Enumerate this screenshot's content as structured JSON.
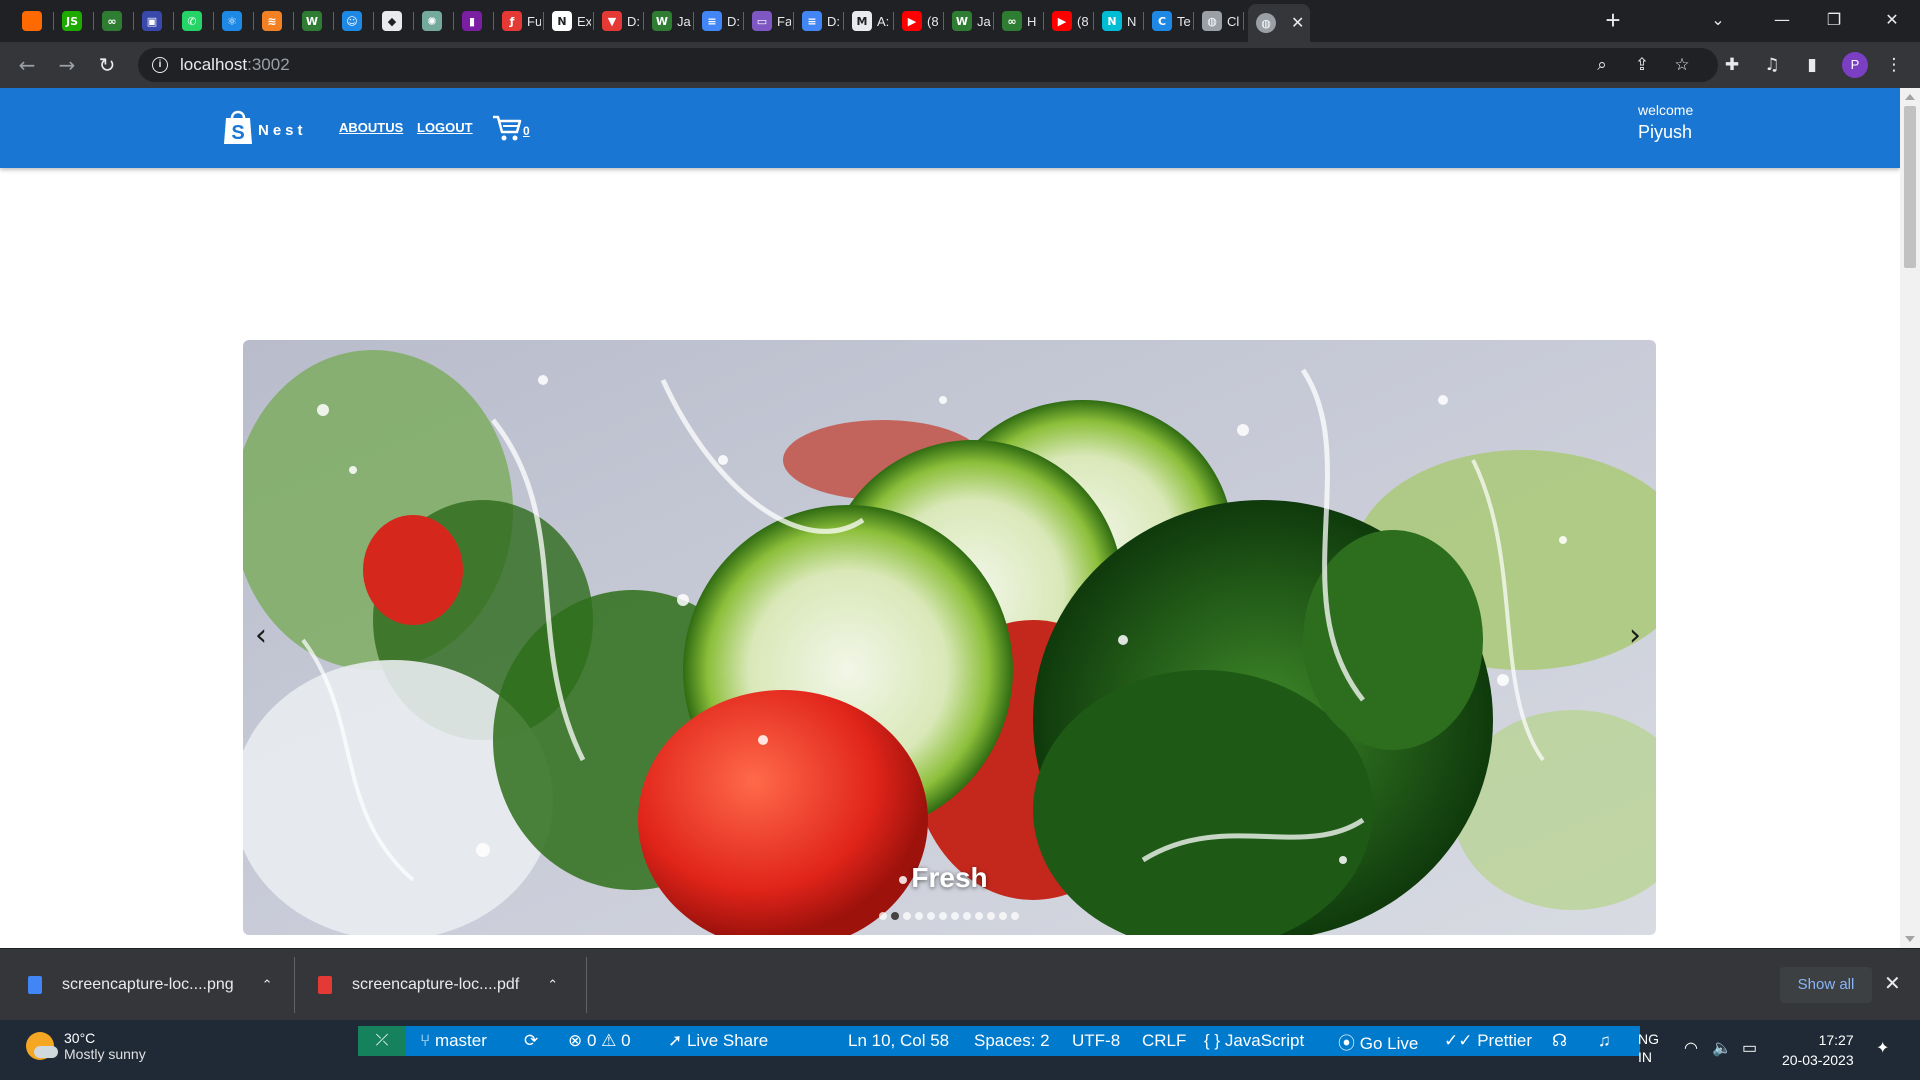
{
  "browser": {
    "tabs": [
      {
        "title": "",
        "icon": "fire-favicon",
        "color": "#ff6a00"
      },
      {
        "title": "",
        "icon": "js-favicon",
        "color": "#1faa00",
        "glyph": "JS"
      },
      {
        "title": "",
        "icon": "infinity-favicon",
        "color": "#2e7d32",
        "glyph": "∞"
      },
      {
        "title": "",
        "icon": "calendar-favicon",
        "color": "#3949ab",
        "glyph": "▣"
      },
      {
        "title": "",
        "icon": "whatsapp-favicon",
        "color": "#25d366",
        "glyph": "✆"
      },
      {
        "title": "",
        "icon": "react-favicon",
        "color": "#1e88e5",
        "glyph": "⚛"
      },
      {
        "title": "",
        "icon": "stack-favicon",
        "color": "#f48024",
        "glyph": "≋"
      },
      {
        "title": "",
        "icon": "w-favicon",
        "color": "#2e7d32",
        "glyph": "W"
      },
      {
        "title": "",
        "icon": "robot-favicon",
        "color": "#1e88e5",
        "glyph": "☺"
      },
      {
        "title": "",
        "icon": "shield-favicon",
        "color": "#e8eaed",
        "glyph": "◆"
      },
      {
        "title": "",
        "icon": "openai-favicon",
        "color": "#74aa9c",
        "glyph": "✺"
      },
      {
        "title": "",
        "icon": "bookmark-favicon",
        "color": "#7b1fa2",
        "glyph": "▮"
      },
      {
        "title": "Fu",
        "icon": "flame-favicon",
        "color": "#e53935",
        "glyph": "ƒ"
      },
      {
        "title": "Ex",
        "icon": "notion-favicon",
        "color": "#ffffff",
        "glyph": "N"
      },
      {
        "title": "D:",
        "icon": "v-favicon",
        "color": "#e53935",
        "glyph": "▼"
      },
      {
        "title": "Ja",
        "icon": "w-favicon",
        "color": "#2e7d32",
        "glyph": "W"
      },
      {
        "title": "D:",
        "icon": "docs-favicon",
        "color": "#4285f4",
        "glyph": "≡"
      },
      {
        "title": "Fa",
        "icon": "window-favicon",
        "color": "#7e57c2",
        "glyph": "▭"
      },
      {
        "title": "D:",
        "icon": "docs-favicon",
        "color": "#4285f4",
        "glyph": "≡"
      },
      {
        "title": "A:",
        "icon": "m-favicon",
        "color": "#e8eaed",
        "glyph": "M"
      },
      {
        "title": "(8",
        "icon": "youtube-favicon",
        "color": "#ff0000",
        "glyph": "▶"
      },
      {
        "title": "Ja",
        "icon": "w-favicon",
        "color": "#2e7d32",
        "glyph": "W"
      },
      {
        "title": "H",
        "icon": "infinity-favicon",
        "color": "#2e7d32",
        "glyph": "∞"
      },
      {
        "title": "(8",
        "icon": "youtube-favicon",
        "color": "#ff0000",
        "glyph": "▶"
      },
      {
        "title": "N",
        "icon": "n-favicon",
        "color": "#00bcd4",
        "glyph": "N"
      },
      {
        "title": "Te",
        "icon": "c-favicon",
        "color": "#1e88e5",
        "glyph": "C"
      },
      {
        "title": "Cl",
        "icon": "globe-favicon",
        "color": "#9aa0a6",
        "glyph": "◍"
      }
    ],
    "active_tab": {
      "icon": "globe-favicon",
      "glyph": "◍"
    },
    "new_tab": "+",
    "window_controls": {
      "tab_search": "⌄",
      "minimize": "—",
      "restore": "❐",
      "close": "✕"
    },
    "address": {
      "host": "localhost",
      "port": ":3002"
    },
    "profile_initial": "P"
  },
  "site": {
    "brand_letter": "S",
    "brand_name": "Nest",
    "nav_links": [
      "ABOUTUS",
      "LOGOUT"
    ],
    "cart_count": "0",
    "welcome_label": "welcome",
    "user_name": "Piyush",
    "colors": {
      "navbar": "#1976d2"
    }
  },
  "carousel": {
    "caption": "Fresh",
    "prev": "‹",
    "next": "›",
    "slide_count": 12,
    "active_index": 1
  },
  "downloads": {
    "items": [
      {
        "name": "screencapture-loc....png",
        "icon": "png-file-icon"
      },
      {
        "name": "screencapture-loc....pdf",
        "icon": "pdf-file-icon"
      }
    ],
    "show_all": "Show all"
  },
  "taskbar": {
    "weather": {
      "temp": "30°C",
      "desc": "Mostly sunny"
    },
    "vscode": {
      "branch": "master",
      "problems": "0",
      "warnings": "0",
      "live_share": "Live Share",
      "position": "Ln 10, Col 58",
      "spaces": "Spaces: 2",
      "encoding": "UTF-8",
      "eol": "CRLF",
      "language": "JavaScript",
      "go_live": "Go Live",
      "prettier": "Prettier"
    },
    "lang": {
      "line1": "NG",
      "line2": "IN"
    },
    "time": "17:27",
    "date": "20-03-2023"
  }
}
